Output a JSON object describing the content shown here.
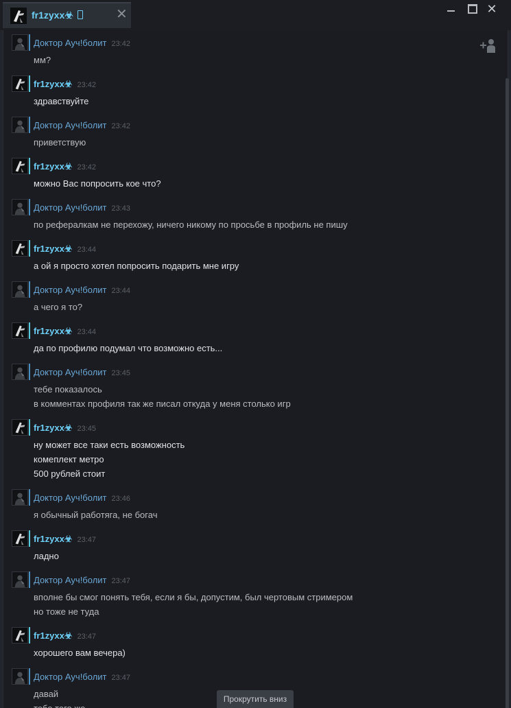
{
  "tab": {
    "name": "fr1zyxx☣",
    "close": "✕"
  },
  "window": {
    "close": "✕"
  },
  "users": {
    "me": "fr1zyxx☣",
    "other": "Доктор Ауч!болит"
  },
  "messages": [
    {
      "from": "other",
      "sender": "Доктор Ауч!болит",
      "time": "23:42",
      "lines": [
        "мм?"
      ]
    },
    {
      "from": "me",
      "sender": "fr1zyxx☣",
      "time": "23:42",
      "lines": [
        "здравствуйте"
      ]
    },
    {
      "from": "other",
      "sender": "Доктор Ауч!болит",
      "time": "23:42",
      "lines": [
        "приветствую"
      ]
    },
    {
      "from": "me",
      "sender": "fr1zyxx☣",
      "time": "23:42",
      "lines": [
        "можно Вас попросить кое что?"
      ]
    },
    {
      "from": "other",
      "sender": "Доктор Ауч!болит",
      "time": "23:43",
      "lines": [
        "по рефералкам не перехожу, ничего никому по просьбе в профиль не пишу"
      ]
    },
    {
      "from": "me",
      "sender": "fr1zyxx☣",
      "time": "23:44",
      "lines": [
        "а ой я просто хотел попросить подарить мне игру"
      ]
    },
    {
      "from": "other",
      "sender": "Доктор Ауч!болит",
      "time": "23:44",
      "lines": [
        "а чего я то?"
      ]
    },
    {
      "from": "me",
      "sender": "fr1zyxx☣",
      "time": "23:44",
      "lines": [
        "да по профилю подумал что возможно есть..."
      ]
    },
    {
      "from": "other",
      "sender": "Доктор Ауч!болит",
      "time": "23:45",
      "lines": [
        "тебе показалось",
        "в комментах профиля так же писал откуда у меня столько игр"
      ]
    },
    {
      "from": "me",
      "sender": "fr1zyxx☣",
      "time": "23:45",
      "lines": [
        "ну может все таки есть возможность",
        "комеплект метро",
        "500 рублей стоит"
      ]
    },
    {
      "from": "other",
      "sender": "Доктор Ауч!болит",
      "time": "23:46",
      "lines": [
        "я обычный работяга, не богач"
      ]
    },
    {
      "from": "me",
      "sender": "fr1zyxx☣",
      "time": "23:47",
      "lines": [
        "ладно"
      ]
    },
    {
      "from": "other",
      "sender": "Доктор Ауч!болит",
      "time": "23:47",
      "lines": [
        "вполне бы смог понять тебя, если я бы, допустим, был чертовым стримером",
        "но тоже не туда"
      ]
    },
    {
      "from": "me",
      "sender": "fr1zyxx☣",
      "time": "23:47",
      "lines": [
        "хорошего вам вечера)"
      ]
    },
    {
      "from": "other",
      "sender": "Доктор Ауч!болит",
      "time": "23:47",
      "lines": [
        "давай",
        "тебе того же"
      ]
    }
  ],
  "scroll_down_label": "Прокрутить вниз",
  "icons": {
    "tab_status": "mobile-icon",
    "add_friend": "add-user-icon"
  },
  "colors": {
    "my_name": "#6dcff6",
    "other_name": "#6aa7d4",
    "background": "#1b1c21"
  }
}
